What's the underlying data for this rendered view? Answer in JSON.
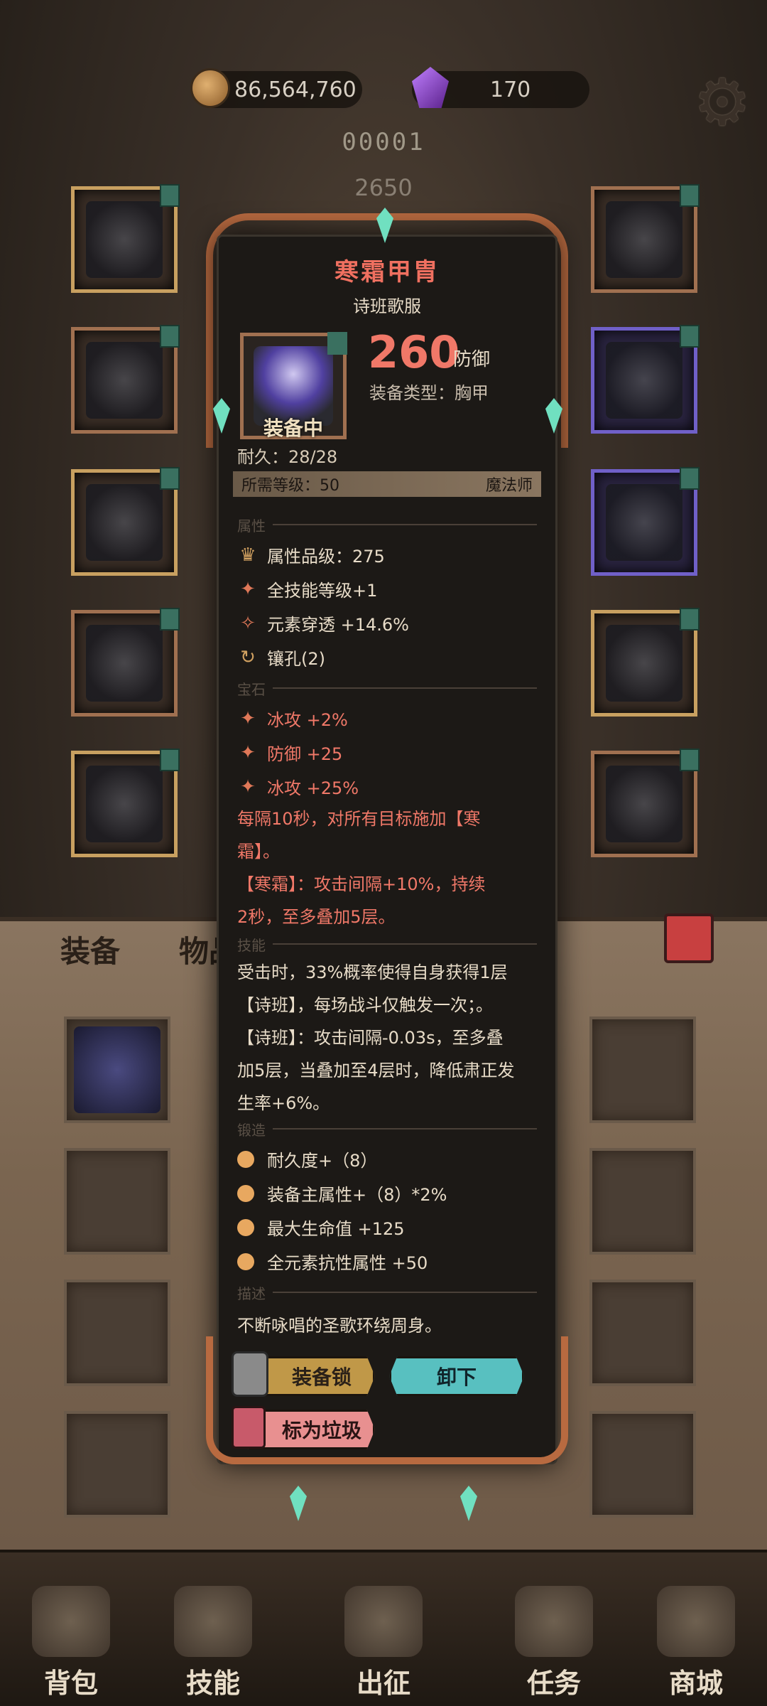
{
  "currency": {
    "coins": "86,564,760",
    "gems": "170"
  },
  "header": {
    "level": "00001",
    "power": "2650"
  },
  "tabs": {
    "equip": "装备",
    "items": "物品"
  },
  "nav": [
    {
      "label": "背包"
    },
    {
      "label": "技能"
    },
    {
      "label": "出征"
    },
    {
      "label": "任务"
    },
    {
      "label": "商城"
    }
  ],
  "item": {
    "name": "寒霜甲胄",
    "set_name": "诗班歌服",
    "equipped_label": "装备中",
    "defense_value": "260",
    "defense_label": "防御",
    "type_line": "装备类型：胸甲",
    "durability": "耐久：28/28",
    "required_level": "所需等级：50",
    "class": "魔法师"
  },
  "sections": {
    "attributes": "属性",
    "gems": "宝石",
    "skill": "技能",
    "forge": "锻造",
    "description": "描述"
  },
  "attributes": [
    {
      "icon": "rank-icon",
      "text": "属性品级：275"
    },
    {
      "icon": "skill-level-icon",
      "text": "全技能等级+1"
    },
    {
      "icon": "element-pierce-icon",
      "text": "元素穿透 +14.6%"
    },
    {
      "icon": "socket-icon",
      "text": "镶孔(2)"
    }
  ],
  "gems": [
    {
      "text": "冰攻 +2%"
    },
    {
      "text": "防御 +25"
    },
    {
      "text": "冰攻 +25%"
    }
  ],
  "gem_effect": {
    "line1": "每隔10秒，对所有目标施加【寒",
    "line2": "霜】。",
    "line3": "【寒霜】：攻击间隔+10%，持续",
    "line4": "2秒，至多叠加5层。"
  },
  "skill_text": {
    "line1": "受击时，33%概率使得自身获得1层",
    "line2": "【诗班】，每场战斗仅触发一次；。",
    "line3": "【诗班】：攻击间隔-0.03s，至多叠",
    "line4": "加5层，当叠加至4层时，降低肃正发",
    "line5": "生率+6%。"
  },
  "forge": [
    {
      "text": "耐久度+（8）"
    },
    {
      "text": "装备主属性+（8）*2%"
    },
    {
      "text": "最大生命值 +125"
    },
    {
      "text": "全元素抗性属性 +50"
    }
  ],
  "description": "不断咏唱的圣歌环绕周身。",
  "buttons": {
    "lock": "装备锁",
    "unequip": "卸下",
    "mark_trash": "标为垃圾"
  }
}
